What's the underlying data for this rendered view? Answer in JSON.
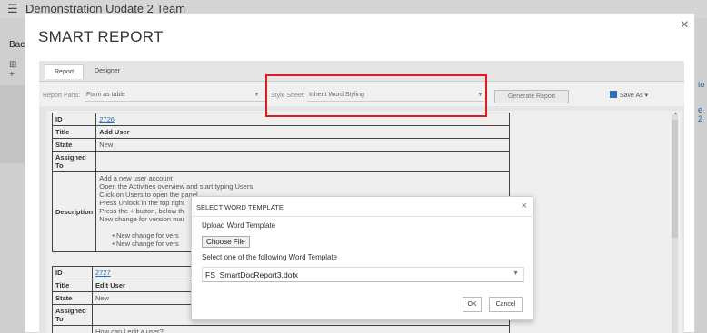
{
  "background_app": {
    "title": "Demonstration Update 2 Team",
    "back_label": "Back",
    "add_symbol": "+",
    "right_text_1": "to",
    "right_text_2": "e 2"
  },
  "smart_report": {
    "title": "SMART REPORT",
    "close_glyph": "×",
    "tabs": [
      {
        "label": "Report",
        "active": true
      },
      {
        "label": "Designer",
        "active": false
      }
    ],
    "report_parts_label": "Report Parts:",
    "report_parts_value": "Form as table",
    "style_sheet_label": "Style Sheet:",
    "style_sheet_value": "Inherit Word Styling",
    "generate_button": "Generate Report",
    "save_as_label": "Save As ▾"
  },
  "work_items": [
    {
      "id_label": "ID",
      "id": "2726",
      "title_label": "Title",
      "title": "Add User",
      "state_label": "State",
      "state": "New",
      "assigned_label": "Assigned To",
      "assigned": "",
      "description_label": "Description",
      "description_lines": [
        "Add a new user account",
        "Open the Activities overview and start typing Users.",
        "Click on Users to open the panel.",
        "Press Unlock in the top right",
        "Press the + button, below th",
        "New change for version mai"
      ],
      "bullets": [
        "New change for vers",
        "New change for vers"
      ]
    },
    {
      "id_label": "ID",
      "id": "2727",
      "title_label": "Title",
      "title": "Edit User",
      "state_label": "State",
      "state": "New",
      "assigned_label": "Assigned To",
      "assigned": "",
      "description_first_line": "How can I edit a user?"
    }
  ],
  "word_template_dialog": {
    "title": "SELECT WORD TEMPLATE",
    "close_glyph": "×",
    "upload_label": "Upload Word Template",
    "choose_file_button": "Choose File",
    "select_label": "Select one of the following Word Template",
    "selected_template": "FS_SmartDocReport3.dotx",
    "ok_button": "OK",
    "cancel_button": "Cancel"
  },
  "colors": {
    "highlight": "#e01b1b",
    "link": "#2a6ebb"
  }
}
